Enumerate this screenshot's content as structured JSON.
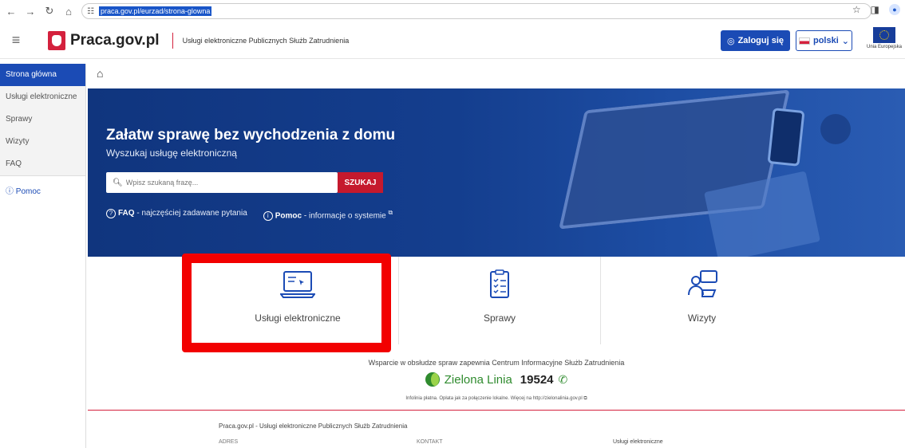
{
  "browser": {
    "url": "praca.gov.pl/eurzad/strona-glowna"
  },
  "header": {
    "logo": "Praca.gov.pl",
    "subtitle": "Usługi elektroniczne Publicznych Służb Zatrudnienia",
    "login": "Zaloguj się",
    "language": "polski",
    "eu_label": "Unia Europejska"
  },
  "sidebar": {
    "items": [
      {
        "label": "Strona główna",
        "active": true
      },
      {
        "label": "Usługi elektroniczne"
      },
      {
        "label": "Sprawy"
      },
      {
        "label": "Wizyty"
      },
      {
        "label": "FAQ"
      }
    ],
    "help": "Pomoc"
  },
  "hero": {
    "title": "Załatw sprawę bez wychodzenia z domu",
    "subtitle": "Wyszukaj usługę elektroniczną",
    "search_placeholder": "Wpisz szukaną frazę...",
    "search_button": "SZUKAJ",
    "faq_bold": "FAQ",
    "faq_text": " - najczęściej zadawane pytania",
    "help_bold": "Pomoc",
    "help_text": " - informacje o systemie"
  },
  "cards": [
    {
      "label": "Usługi elektroniczne",
      "icon": "laptop-icon"
    },
    {
      "label": "Sprawy",
      "icon": "checklist-icon"
    },
    {
      "label": "Wizyty",
      "icon": "meeting-icon"
    }
  ],
  "support": {
    "text": "Wsparcie w obsłudze spraw zapewnia Centrum Informacyjne Służb Zatrudnienia",
    "line_name": "Zielona Linia",
    "line_number": "19524",
    "infolinia": "Infolinia płatna. Opłata jak za połączenie lokalne. Więcej na http://zielonalinia.gov.pl"
  },
  "footer": {
    "title": "Praca.gov.pl - Usługi elektroniczne Publicznych Służb Zatrudnienia",
    "col1": "ADRES",
    "col2": "KONTAKT",
    "col3": "Usługi elektroniczne"
  },
  "colors": {
    "primary": "#1b4bb5",
    "accent": "#c5192d",
    "highlight": "#f20000",
    "green": "#2f8b2e"
  }
}
